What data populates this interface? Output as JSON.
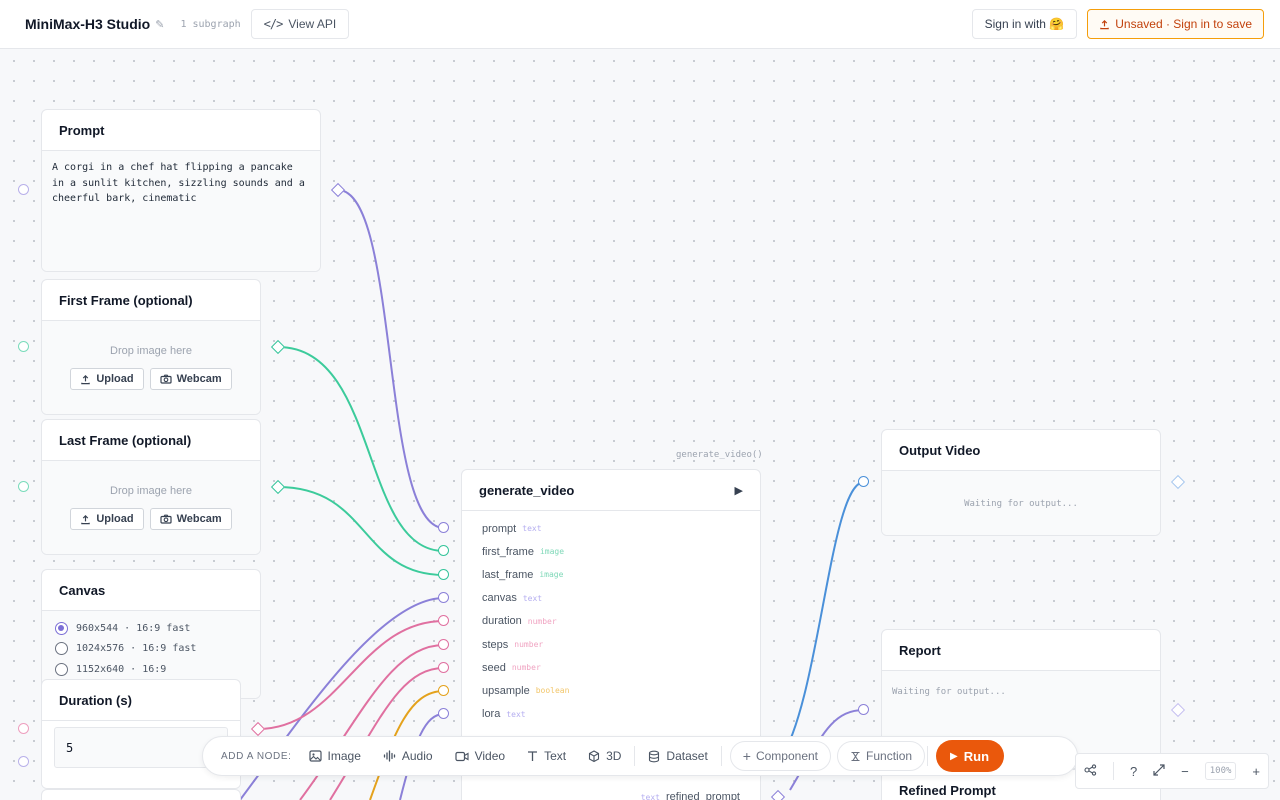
{
  "header": {
    "title": "MiniMax-H3 Studio",
    "subgraph": "1 subgraph",
    "view_api": "View API",
    "sign_in": "Sign in with 🤗",
    "unsaved": "Unsaved · Sign in to save"
  },
  "nodes": {
    "prompt": {
      "title": "Prompt",
      "value": "A corgi in a chef hat flipping a pancake in a sunlit kitchen, sizzling sounds and a cheerful bark, cinematic"
    },
    "first_frame": {
      "title": "First Frame (optional)",
      "drop": "Drop image here",
      "upload": "Upload",
      "webcam": "Webcam"
    },
    "last_frame": {
      "title": "Last Frame (optional)",
      "drop": "Drop image here",
      "upload": "Upload",
      "webcam": "Webcam"
    },
    "canvas": {
      "title": "Canvas",
      "options": [
        "960x544 · 16:9 fast",
        "1024x576 · 16:9 fast",
        "1152x640 · 16:9"
      ],
      "selected": "960x544 · 16:9 fast"
    },
    "duration": {
      "title": "Duration (s)",
      "value": "5"
    },
    "generate_video": {
      "fn_label": "generate_video()",
      "title": "generate_video",
      "run_icon": "play-icon",
      "inputs": [
        {
          "name": "prompt",
          "type": "text"
        },
        {
          "name": "first_frame",
          "type": "image"
        },
        {
          "name": "last_frame",
          "type": "image"
        },
        {
          "name": "canvas",
          "type": "text"
        },
        {
          "name": "duration",
          "type": "number"
        },
        {
          "name": "steps",
          "type": "number"
        },
        {
          "name": "seed",
          "type": "number"
        },
        {
          "name": "upsample",
          "type": "boolean"
        },
        {
          "name": "lora",
          "type": "text"
        }
      ],
      "output_partial": {
        "name": "refined_prompt",
        "type": "text"
      }
    },
    "output_video": {
      "title": "Output Video",
      "waiting": "Waiting for output..."
    },
    "report": {
      "title": "Report",
      "waiting": "Waiting for output..."
    },
    "refined_prompt": {
      "title": "Refined Prompt"
    }
  },
  "toolbar": {
    "add_label": "ADD A NODE:",
    "items": [
      "Image",
      "Audio",
      "Video",
      "Text",
      "3D",
      "Dataset"
    ],
    "component": "Component",
    "function": "Function",
    "run": "Run"
  },
  "zoom": {
    "value": "100%"
  },
  "colors": {
    "text": "#9b8fe0",
    "image": "#34c49a",
    "number": "#e17aa1",
    "boolean": "#e4a21c",
    "video": "#4a90d9",
    "accent": "#ea580c"
  }
}
